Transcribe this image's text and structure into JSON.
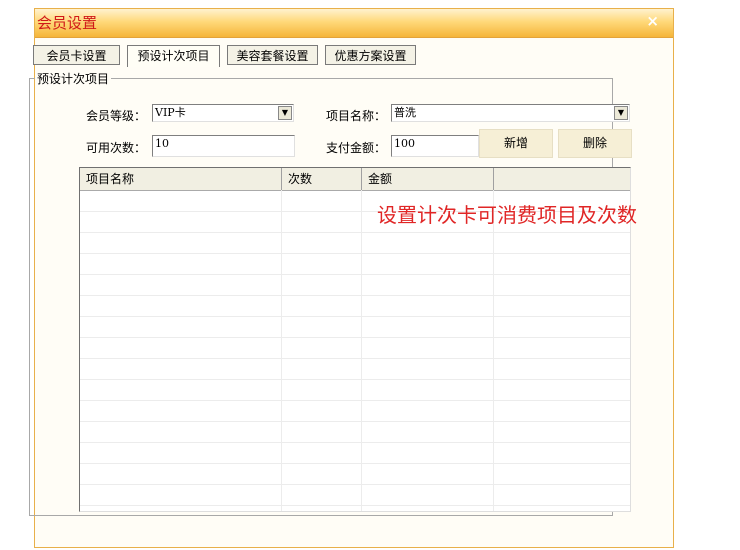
{
  "window": {
    "title": "会员设置",
    "close_symbol": "×"
  },
  "tabs": [
    "会员卡设置",
    "预设计次项目",
    "美容套餐设置",
    "优惠方案设置"
  ],
  "group": {
    "label": "预设计次项目"
  },
  "form": {
    "member_level_label": "会员等级：",
    "member_level_value": "VIP卡",
    "item_name_label": "项目名称：",
    "item_name_value": "普洗",
    "available_times_label": "可用次数：",
    "available_times_value": "10",
    "pay_amount_label": "支付金额：",
    "pay_amount_value": "100",
    "add_button": "新增",
    "delete_button": "删除"
  },
  "table": {
    "columns": [
      "项目名称",
      "次数",
      "金额",
      ""
    ]
  },
  "annotation": "设置计次卡可消费项目及次数",
  "colors": {
    "title": "#d01818",
    "annotation": "#e02626",
    "title_bar": "#f5b53a"
  }
}
